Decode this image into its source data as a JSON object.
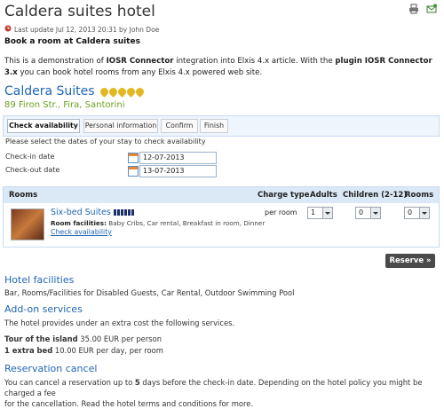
{
  "header": {
    "title": "Caldera suites hotel",
    "last_update": "Last update Jul 12, 2013 20:31 by John Doe",
    "subtitle": "Book a room at Caldera suites"
  },
  "intro": {
    "t1": "This is a demonstration of ",
    "b1": "IOSR Connector",
    "t2": " integration into Elxis 4.x article. With the ",
    "b2": "plugin IOSR Connector 3.x",
    "t3": " you can book hotel rooms from any Elxis 4.x powered web site."
  },
  "hotel": {
    "name": "Caldera Suites",
    "stars": 5,
    "address": "89 Firon Str., Fira, Santorini"
  },
  "tabs": [
    "Check availability",
    "Personal information",
    "Confirm",
    "Finish"
  ],
  "availability": {
    "prompt": "Please select the dates of your stay to check availability",
    "checkin_label": "Check-in date",
    "checkin_value": "12-07-2013",
    "checkout_label": "Check-out date",
    "checkout_value": "13-07-2013"
  },
  "rooms_table": {
    "headers": [
      "Rooms",
      "Charge type",
      "Adults",
      "Children (2-12)",
      "Rooms"
    ],
    "room": {
      "name": "Six-bed Suites",
      "persons": 6,
      "facilities_label": "Room facilities:",
      "facilities": "Baby Cribs, Car rental, Breakfast in room, Dinner",
      "check_link": "Check availability",
      "charge": "per room",
      "adults": "1",
      "children": "0",
      "rooms": "0"
    }
  },
  "reserve_button": "Reserve »",
  "facilities": {
    "title": "Hotel facilities",
    "text": "Bar, Rooms/Facilities for Disabled Guests, Car Rental, Outdoor Swimming Pool"
  },
  "addons": {
    "title": "Add-on services",
    "text": "The hotel provides under an extra cost the following services.",
    "items": [
      {
        "name": "Tour of the island",
        "price": "35.00 EUR per person"
      },
      {
        "name": "1 extra bed",
        "price": "10.00 EUR per day, per room"
      }
    ]
  },
  "cancel": {
    "title": "Reservation cancel",
    "t1": "You can cancel a reservation up to ",
    "days": "5",
    "t2": " days before the check-in date. Depending on the hotel policy you might be charged a fee",
    "t3": "for the cancellation. Read the hotel terms and conditions for more."
  },
  "colors": {
    "link": "#1f66b3",
    "address": "#6aa11e",
    "button": "#4a4a4a"
  }
}
